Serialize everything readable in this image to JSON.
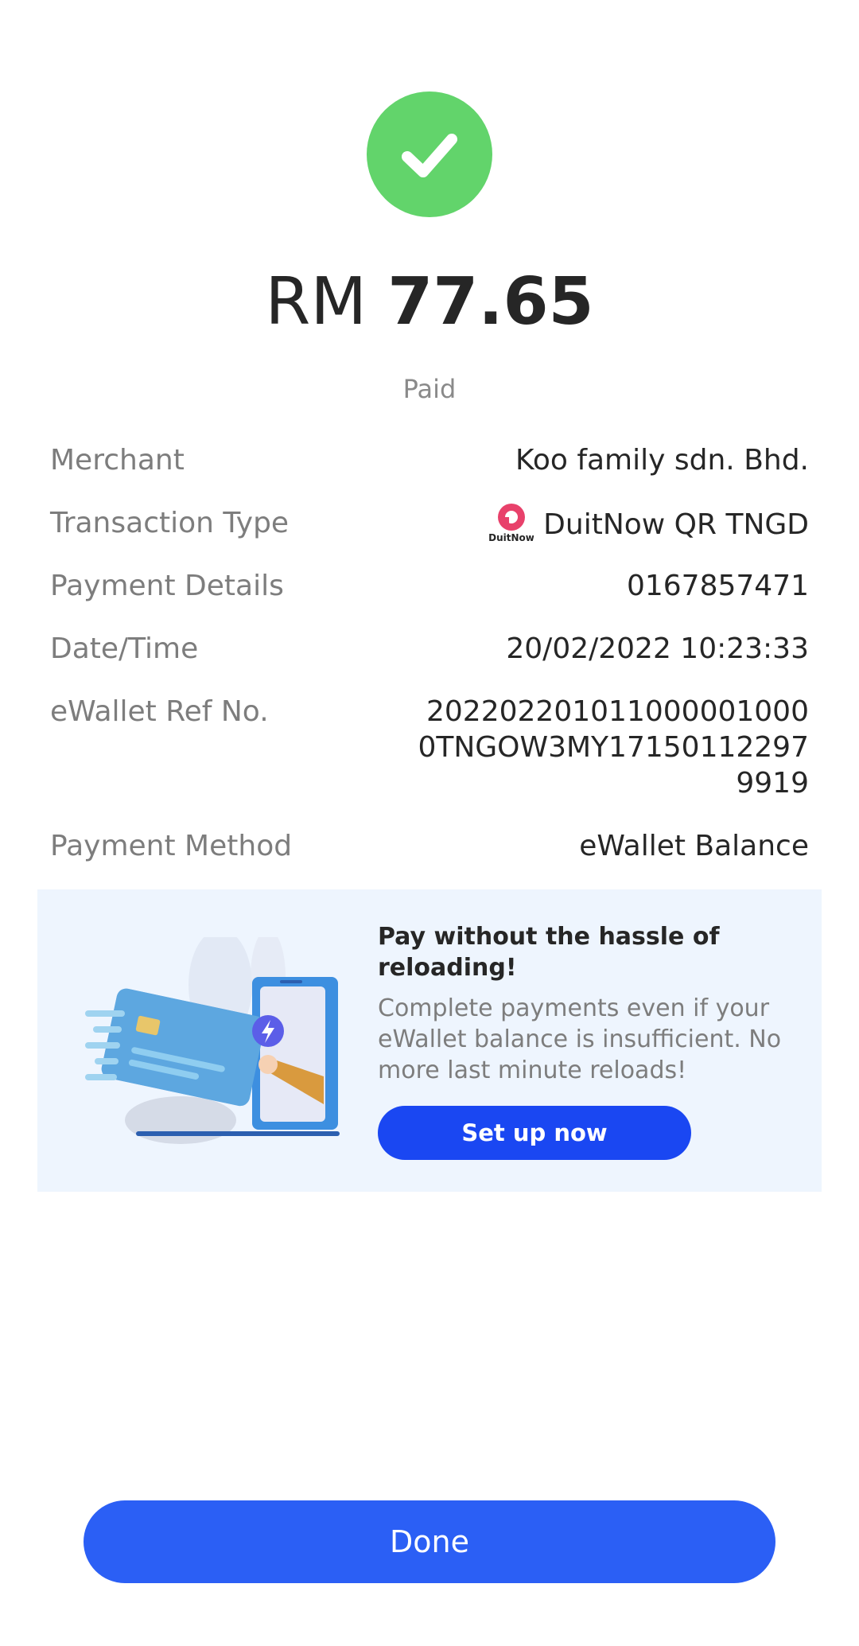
{
  "status_icon": "check-circle-icon",
  "colors": {
    "success": "#62d46b",
    "primary": "#2b5ff5",
    "promo_bg": "#eef5fe",
    "label": "#7d7d7d",
    "duitnow_brand": "#e8416b"
  },
  "amount": {
    "currency": "RM",
    "value": "77.65"
  },
  "status_text": "Paid",
  "details": {
    "merchant": {
      "label": "Merchant",
      "value": "Koo family sdn. Bhd."
    },
    "transaction_type": {
      "label": "Transaction Type",
      "logo_text": "DuitNow",
      "value": "DuitNow QR TNGD"
    },
    "payment_details": {
      "label": "Payment Details",
      "value": "0167857471"
    },
    "date_time": {
      "label": "Date/Time",
      "value": "20/02/2022 10:23:33"
    },
    "ewallet_ref": {
      "label": "eWallet Ref No.",
      "value": "20220220101100000100​00TNGOW3MY171501122979919"
    },
    "payment_method": {
      "label": "Payment Method",
      "value": "eWallet Balance"
    }
  },
  "promo": {
    "title": "Pay without the hassle of reloading!",
    "description": "Complete payments even if your eWallet balance is insufficient. No more last minute reloads!",
    "button_label": "Set up now"
  },
  "done_label": "Done"
}
